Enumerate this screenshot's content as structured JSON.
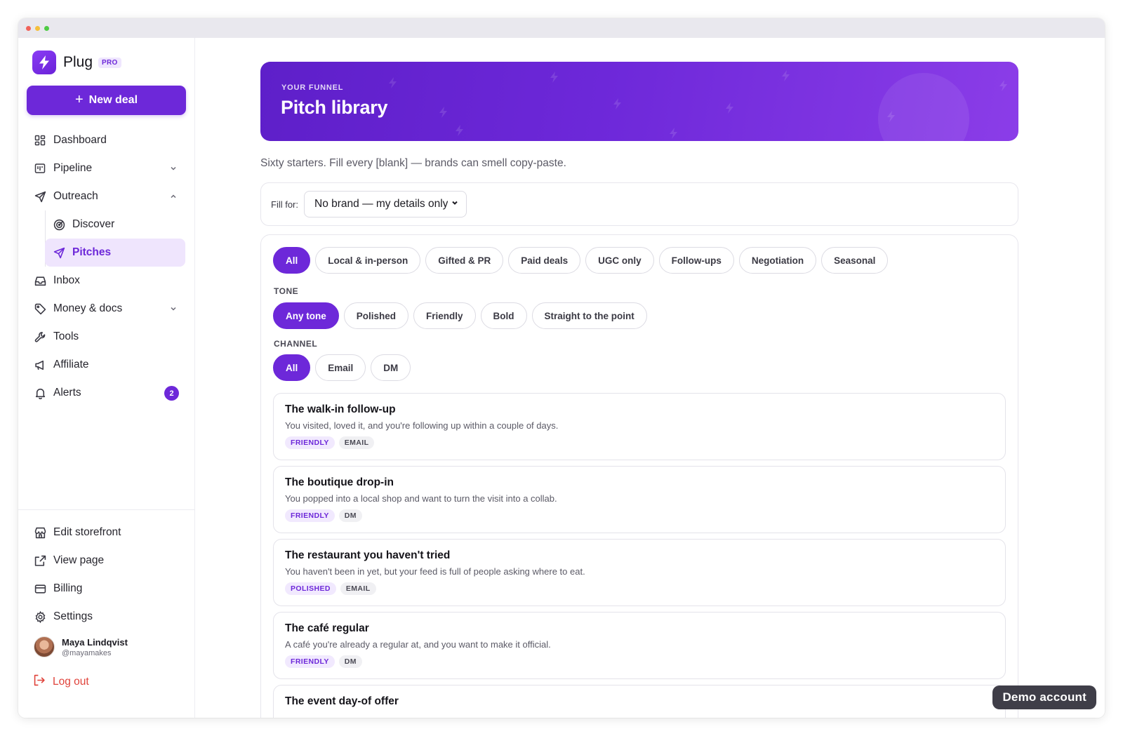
{
  "brand": {
    "name": "Plug",
    "badge": "PRO"
  },
  "new_deal_label": "New deal",
  "nav": {
    "dashboard": "Dashboard",
    "pipeline": "Pipeline",
    "outreach": "Outreach",
    "discover": "Discover",
    "pitches": "Pitches",
    "inbox": "Inbox",
    "money_docs": "Money & docs",
    "tools": "Tools",
    "affiliate": "Affiliate",
    "alerts": "Alerts",
    "alerts_count": "2"
  },
  "bottom_nav": {
    "edit_storefront": "Edit storefront",
    "view_page": "View page",
    "billing": "Billing",
    "settings": "Settings"
  },
  "user": {
    "name": "Maya Lindqvist",
    "handle": "@mayamakes"
  },
  "logout_label": "Log out",
  "hero": {
    "eyebrow": "YOUR FUNNEL",
    "title": "Pitch library"
  },
  "subtitle": "Sixty starters. Fill every [blank] — brands can smell copy-paste.",
  "fill": {
    "label": "Fill for:",
    "selected": "No brand — my details only"
  },
  "categories": [
    "All",
    "Local & in-person",
    "Gifted & PR",
    "Paid deals",
    "UGC only",
    "Follow-ups",
    "Negotiation",
    "Seasonal"
  ],
  "tone": {
    "label": "TONE",
    "options": [
      "Any tone",
      "Polished",
      "Friendly",
      "Bold",
      "Straight to the point"
    ]
  },
  "channel": {
    "label": "CHANNEL",
    "options": [
      "All",
      "Email",
      "DM"
    ]
  },
  "pitches": [
    {
      "title": "The walk-in follow-up",
      "desc": "You visited, loved it, and you're following up within a couple of days.",
      "tone": "FRIENDLY",
      "channel": "EMAIL"
    },
    {
      "title": "The boutique drop-in",
      "desc": "You popped into a local shop and want to turn the visit into a collab.",
      "tone": "FRIENDLY",
      "channel": "DM"
    },
    {
      "title": "The restaurant you haven't tried",
      "desc": "You haven't been in yet, but your feed is full of people asking where to eat.",
      "tone": "POLISHED",
      "channel": "EMAIL"
    },
    {
      "title": "The café regular",
      "desc": "A café you're already a regular at, and you want to make it official.",
      "tone": "FRIENDLY",
      "channel": "DM"
    },
    {
      "title": "The event day-of offer",
      "desc": "",
      "tone": "",
      "channel": ""
    }
  ],
  "demo_label": "Demo account",
  "colors": {
    "accent": "#6d28d9",
    "accent_light": "#efe5fd",
    "danger": "#e0433b"
  }
}
